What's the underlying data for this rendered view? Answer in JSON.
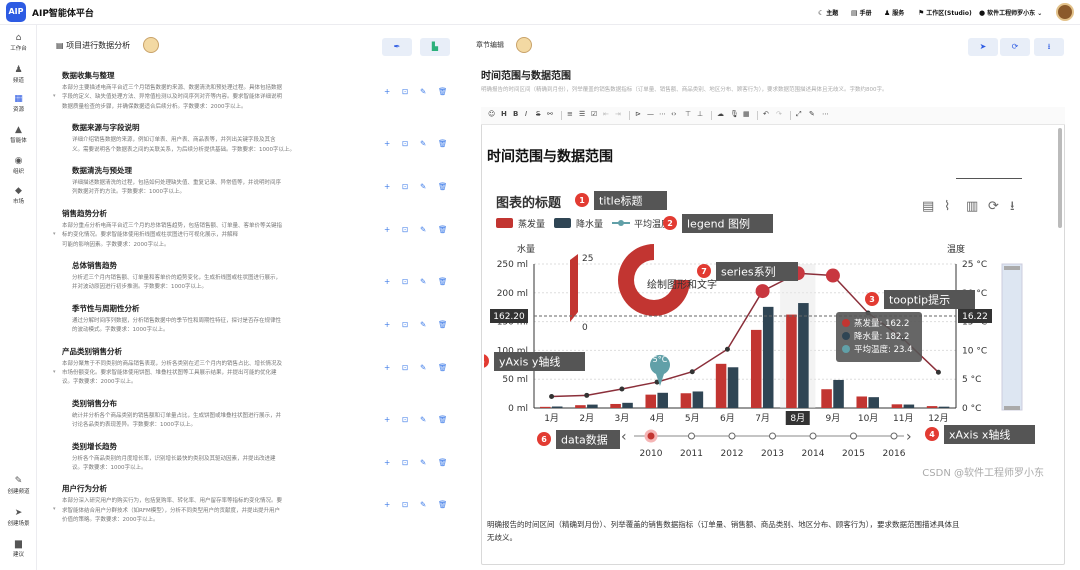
{
  "app": {
    "logo": "AIP",
    "title": "AIP智能体平台"
  },
  "topbar": {
    "theme": "主题",
    "manual": "手册",
    "service": "服务",
    "workspace": "工作区(Studio)",
    "user": "软件工程师罗小东"
  },
  "sidebar": [
    {
      "label": "工作台",
      "icon": "home-icon"
    },
    {
      "label": "频道",
      "icon": "users-icon"
    },
    {
      "label": "资源",
      "icon": "grid-icon"
    },
    {
      "label": "智能体",
      "icon": "agent-icon"
    },
    {
      "label": "组织",
      "icon": "org-icon"
    },
    {
      "label": "市场",
      "icon": "market-icon"
    },
    {
      "label": "创建频道",
      "icon": "pen-icon"
    },
    {
      "label": "创建场景",
      "icon": "send-icon"
    },
    {
      "label": "建议",
      "icon": "chat-icon"
    }
  ],
  "left": {
    "title": "项目进行数据分析",
    "items": [
      {
        "title": "数据收集与整理",
        "level": 1,
        "desc": [
          "本部分主要描述电商平台近三个月销售数据的来源、数据清洗和预处理过程。具体包括数据",
          "字段的定义、缺失值处理方法、异常值检测以及时间序列对齐等内容。要求智能体详细说明",
          "数据质量检查的步骤，并确保数据适合后续分析。字数要求：2000字以上。"
        ]
      },
      {
        "title": "数据来源与字段说明",
        "level": 2,
        "desc": [
          "详细介绍销售数据的来源，例如订单表、用户表、商品表等，并列出关键字段及其含",
          "义。需要说明各个数据表之间的关联关系，为后续分析提供基础。字数要求：1000字以上。"
        ]
      },
      {
        "title": "数据清洗与预处理",
        "level": 2,
        "desc": [
          "详细描述数据清洗的过程，包括如何处理缺失值、重复记录、异常值等，并说明时间序",
          "列数据对齐的方法。字数要求：1000字以上。"
        ]
      },
      {
        "title": "销售趋势分析",
        "level": 1,
        "desc": [
          "本部分重点分析电商平台近三个月的总体销售趋势，包括销售额、订单量、客单价等关键指",
          "标的变化情况。要求智能体使用折线图或柱状图进行可视化展示，并解释",
          "可能的影响因素。字数要求：2000字以上。"
        ]
      },
      {
        "title": "总体销售趋势",
        "level": 2,
        "desc": [
          "分析近三个月内销售额、订单量和客单价的趋势变化，生成折线图或柱状图进行展示，",
          "并对波动原因进行初步推测。字数要求：1000字以上。"
        ]
      },
      {
        "title": "季节性与周期性分析",
        "level": 2,
        "desc": [
          "通过分解时间序列数据，分析销售数据中的季节性和周期性特征，探讨是否存在规律性",
          "的波动模式。字数要求：1000字以上。"
        ]
      },
      {
        "title": "产品类别销售分析",
        "level": 1,
        "desc": [
          "本部分聚焦于不同类别的商品销售表现，分析各类别在近三个月内的销售占比、增长情况及",
          "市场份额变化。要求智能体使用饼图、堆叠柱状图等工具展示结果，并提出可能的优化建",
          "议。字数要求：2000字以上。"
        ]
      },
      {
        "title": "类别销售分布",
        "level": 2,
        "desc": [
          "统计并分析各个商品类别的销售额和订单量占比，生成饼图或堆叠柱状图进行展示，并",
          "讨论各品类的表现差异。字数要求：1000字以上。"
        ]
      },
      {
        "title": "类别增长趋势",
        "level": 2,
        "desc": [
          "分析各个商品类别的月度增长率，识别增长最快的类别及其驱动因素，并提出改进建",
          "议。字数要求：1000字以上。"
        ]
      },
      {
        "title": "用户行为分析",
        "level": 1,
        "desc": [
          "本部分深入研究用户的购买行为，包括复购率、转化率、用户留存率等指标的变化情况。要",
          "求智能体结合用户分群技术（如RFM模型），分析不同类型用户的贡献度，并提出提升用户",
          "价值的策略。字数要求：2000字以上。"
        ]
      }
    ]
  },
  "right": {
    "label": "章节编辑",
    "heading": "时间范围与数据范围",
    "subtitle": "明确报告的时间区间（精确到月份），列举覆盖的销售数据指标（订单量、销售额、商品类别、地区分布、顾客行为），要求数据范围描述具体且无歧义。字数约800字。",
    "editor_heading": "时间范围与数据范围",
    "body_text": [
      "明确报告的时间区间（精确到月份）、列举覆盖的销售数据指标（订单量、销售额、商品类别、地区分布、顾客行为），要求数据范围描述具体且",
      "无歧义。"
    ]
  },
  "chart_data": {
    "type": "bar",
    "title": "图表的标题",
    "categories": [
      "1月",
      "2月",
      "3月",
      "4月",
      "5月",
      "6月",
      "7月",
      "8月",
      "9月",
      "10月",
      "11月",
      "12月"
    ],
    "series": [
      {
        "name": "蒸发量",
        "type": "bar",
        "color": "#c23531",
        "values": [
          2.0,
          4.9,
          7.0,
          23.2,
          25.6,
          76.7,
          135.6,
          162.2,
          32.6,
          20.0,
          6.4,
          3.3
        ]
      },
      {
        "name": "降水量",
        "type": "bar",
        "color": "#2f4554",
        "values": [
          2.6,
          5.9,
          9.0,
          26.4,
          28.7,
          70.7,
          175.6,
          182.2,
          48.7,
          18.8,
          6.0,
          2.3
        ]
      },
      {
        "name": "平均温度",
        "type": "line",
        "color": "#61a0a8",
        "axis": "right",
        "values": [
          2.0,
          2.2,
          3.3,
          4.5,
          6.3,
          10.2,
          20.3,
          23.4,
          23.0,
          16.5,
          12.0,
          6.2
        ]
      }
    ],
    "ylabel": "水量",
    "y2label": "温度",
    "yticks": [
      "0 ml",
      "50 ml",
      "100 ml",
      "150 ml",
      "200 ml",
      "250 ml"
    ],
    "y2ticks": [
      "0 °C",
      "5 °C",
      "10 °C",
      "15 °C",
      "20 °C",
      "25 °C"
    ],
    "ylim": [
      0,
      250
    ],
    "y2lim": [
      0,
      25
    ],
    "timeline": [
      "2010",
      "2011",
      "2012",
      "2013",
      "2014",
      "2015",
      "2016"
    ],
    "axis_pointer_left": "162.20",
    "axis_pointer_right": "16.22",
    "markpoint": "5°C",
    "gauge_labels": [
      "25",
      "0"
    ],
    "graphic_text": "绘制图形和文字",
    "tooltip": {
      "lines": [
        "蒸发量: 162.2",
        "降水量: 182.2",
        "平均温度: 23.4"
      ],
      "category": "8月"
    },
    "grid": true,
    "legend_position": "top-left",
    "watermark": "CSDN @软件工程师罗小东",
    "annotations": [
      {
        "n": "1",
        "text": "title标题"
      },
      {
        "n": "2",
        "text": "legend 图例"
      },
      {
        "n": "3",
        "text": "tooptip提示"
      },
      {
        "n": "4",
        "text": "xAxis x轴线"
      },
      {
        "n": "5",
        "text": "yAxis y轴线"
      },
      {
        "n": "6",
        "text": "data数据"
      },
      {
        "n": "7",
        "text": "series系列"
      }
    ]
  }
}
